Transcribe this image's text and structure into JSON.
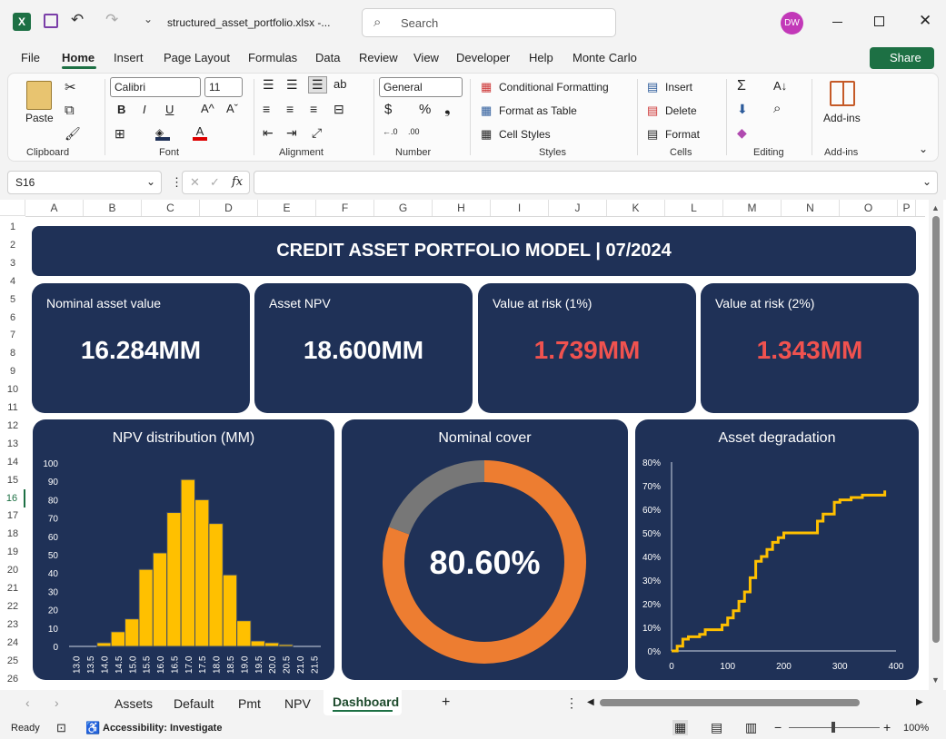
{
  "window": {
    "filename": "structured_asset_portfolio.xlsx  -...",
    "search_placeholder": "Search",
    "user_initials": "DW"
  },
  "menu": [
    "File",
    "Home",
    "Insert",
    "Page Layout",
    "Formulas",
    "Data",
    "Review",
    "View",
    "Developer",
    "Help",
    "Monte Carlo"
  ],
  "share_label": "Share",
  "ribbon": {
    "clipboard": {
      "label": "Clipboard",
      "paste": "Paste"
    },
    "font": {
      "label": "Font",
      "name": "Calibri",
      "size": "11",
      "bold": "B",
      "italic": "I",
      "underline": "U"
    },
    "alignment": {
      "label": "Alignment"
    },
    "number": {
      "label": "Number",
      "format": "General"
    },
    "styles": {
      "label": "Styles",
      "cond": "Conditional Formatting",
      "table": "Format as Table",
      "cell": "Cell Styles"
    },
    "cells": {
      "label": "Cells",
      "insert": "Insert",
      "delete": "Delete",
      "format": "Format"
    },
    "editing": {
      "label": "Editing"
    },
    "addins": {
      "label": "Add-ins",
      "btn": "Add-ins"
    }
  },
  "formula": {
    "namebox": "S16",
    "fx": "fx",
    "content": ""
  },
  "columns": [
    "A",
    "B",
    "C",
    "D",
    "E",
    "F",
    "G",
    "H",
    "I",
    "J",
    "K",
    "L",
    "M",
    "N",
    "O",
    "P"
  ],
  "rows": [
    "1",
    "2",
    "3",
    "4",
    "5",
    "6",
    "7",
    "8",
    "9",
    "10",
    "11",
    "12",
    "13",
    "14",
    "15",
    "16",
    "17",
    "18",
    "19",
    "20",
    "21",
    "22",
    "23",
    "24",
    "25",
    "26"
  ],
  "dashboard": {
    "title": "CREDIT ASSET PORTFOLIO MODEL | 07/2024",
    "kpis": [
      {
        "label": "Nominal asset value",
        "value": "16.284MM",
        "color": "#ffffff"
      },
      {
        "label": "Asset NPV",
        "value": "18.600MM",
        "color": "#ffffff"
      },
      {
        "label": "Value at risk (1%)",
        "value": "1.739MM",
        "color": "#f0524f"
      },
      {
        "label": "Value at risk (2%)",
        "value": "1.343MM",
        "color": "#f0524f"
      }
    ],
    "hist_title": "NPV distribution (MM)",
    "donut_title": "Nominal cover",
    "donut_value": "80.60%",
    "line_title": "Asset degradation"
  },
  "chart_data": [
    {
      "type": "bar",
      "title": "NPV distribution (MM)",
      "categories": [
        "13.0",
        "13.5",
        "14.0",
        "14.5",
        "15.0",
        "15.5",
        "16.0",
        "16.5",
        "17.0",
        "17.5",
        "18.0",
        "18.5",
        "19.0",
        "19.5",
        "20.0",
        "20.5",
        "21.0",
        "21.5"
      ],
      "values": [
        0,
        0,
        2,
        8,
        15,
        42,
        51,
        73,
        91,
        80,
        67,
        39,
        14,
        3,
        2,
        1,
        0,
        0
      ],
      "ylim": [
        0,
        100
      ],
      "yticks": [
        "0",
        "10",
        "20",
        "30",
        "40",
        "50",
        "60",
        "70",
        "80",
        "90",
        "100"
      ],
      "colors": {
        "bar": "#ffc000",
        "edge": "#3a4a6b"
      }
    },
    {
      "type": "pie",
      "title": "Nominal cover",
      "values": [
        80.6,
        19.4
      ],
      "label": "80.60%",
      "colors": [
        "#ed7d31",
        "#777777"
      ]
    },
    {
      "type": "line",
      "title": "Asset degradation",
      "xlim": [
        0,
        400
      ],
      "ylim": [
        0,
        0.8
      ],
      "xticks": [
        "0",
        "100",
        "200",
        "300",
        "400"
      ],
      "yticks": [
        "0%",
        "10%",
        "20%",
        "30%",
        "40%",
        "50%",
        "60%",
        "70%",
        "80%"
      ],
      "x": [
        0,
        10,
        20,
        30,
        50,
        60,
        80,
        90,
        100,
        110,
        120,
        130,
        140,
        150,
        160,
        170,
        180,
        190,
        200,
        220,
        240,
        260,
        270,
        290,
        300,
        320,
        340,
        350,
        380
      ],
      "y": [
        0,
        0.02,
        0.05,
        0.06,
        0.07,
        0.09,
        0.09,
        0.11,
        0.14,
        0.17,
        0.21,
        0.25,
        0.31,
        0.38,
        0.4,
        0.43,
        0.46,
        0.48,
        0.5,
        0.5,
        0.5,
        0.55,
        0.58,
        0.63,
        0.64,
        0.65,
        0.66,
        0.66,
        0.68
      ],
      "color": "#ffc000"
    }
  ],
  "sheets": [
    "Assets",
    "Default",
    "Pmt",
    "NPV",
    "Dashboard"
  ],
  "status": {
    "ready": "Ready",
    "accessibility": "Accessibility: Investigate",
    "zoom": "100%"
  }
}
